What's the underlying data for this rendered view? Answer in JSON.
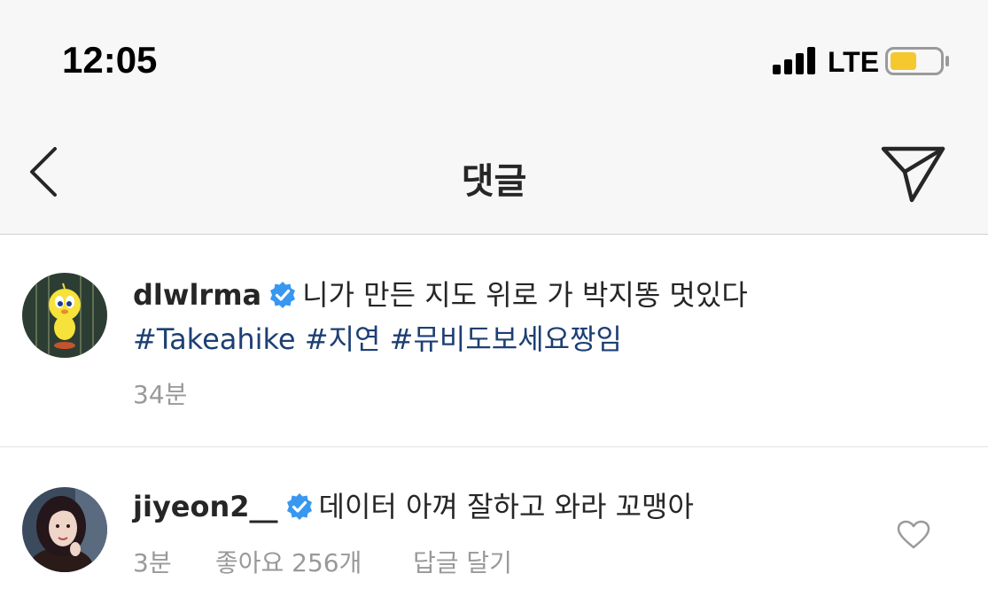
{
  "status_bar": {
    "time": "12:05",
    "network": "LTE"
  },
  "header": {
    "title": "댓글",
    "back_icon": "chevron-left-icon",
    "share_icon": "paper-plane-icon"
  },
  "comments": [
    {
      "username": "dlwlrma",
      "verified": true,
      "text": "니가 만든 지도 위로 가 박지똥 멋있다",
      "hashtags": [
        "#Takeahike",
        "#지연",
        "#뮤비도보세요짱임"
      ],
      "time": "34분"
    },
    {
      "username": "jiyeon2__",
      "verified": true,
      "text": "데이터 아껴 잘하고 와라 꼬맹아",
      "time": "3분",
      "likes_label": "좋아요 256개",
      "reply_label": "답글 달기"
    }
  ],
  "colors": {
    "hashtag": "#1d3f74",
    "verified_badge": "#3897f0",
    "meta": "#999999",
    "battery": "#f5c830"
  }
}
